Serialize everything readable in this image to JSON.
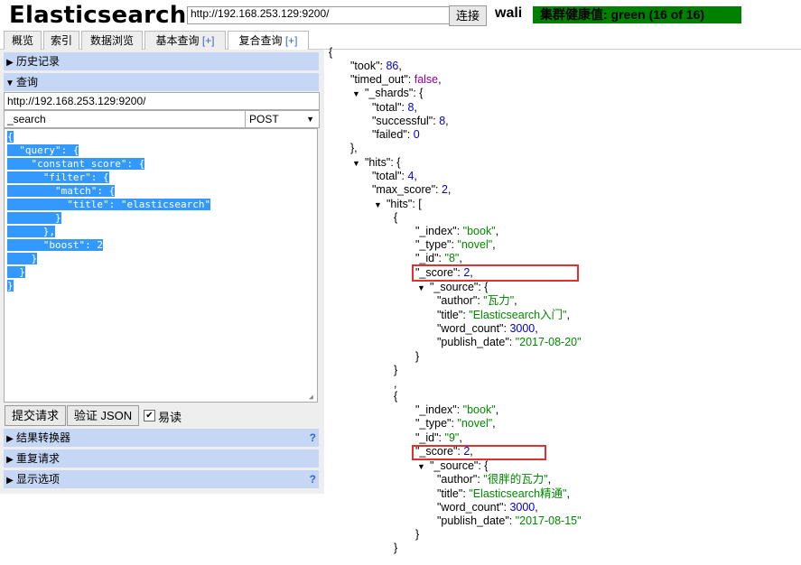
{
  "header": {
    "logo": "Elasticsearch",
    "url": "http://192.168.253.129:9200/",
    "connect_label": "连接",
    "cluster_name": "wali",
    "health": "集群健康值: green (16 of 16)"
  },
  "tabs": [
    {
      "label": "概览",
      "plus": ""
    },
    {
      "label": "索引",
      "plus": ""
    },
    {
      "label": "数据浏览",
      "plus": ""
    },
    {
      "label": "基本查询",
      "plus": "[+]"
    },
    {
      "label": "复合查询",
      "plus": "[+]"
    }
  ],
  "left": {
    "history_label": "历史记录",
    "query_label": "查询",
    "query_url": "http://192.168.253.129:9200/",
    "query_path": "_search",
    "method": "POST",
    "request_body": [
      "{",
      "  \"query\": {",
      "    \"constant_score\": {",
      "      \"filter\": {",
      "        \"match\": {",
      "          \"title\": \"elasticsearch\"",
      "        }",
      "      },",
      "      \"boost\": 2",
      "    }",
      "  }",
      "}"
    ],
    "submit_label": "提交请求",
    "validate_label": "验证 JSON",
    "readonly_label": "易读",
    "transformer_label": "结果转换器",
    "repeat_label": "重复请求",
    "display_label": "显示选项",
    "help_mark": "?"
  },
  "result": {
    "took": "86",
    "timed_out": "false",
    "shards_total": "8",
    "shards_successful": "8",
    "shards_failed": "0",
    "hits_total": "4",
    "max_score": "2",
    "hit1": {
      "index": "\"book\"",
      "type": "\"novel\"",
      "id": "\"8\"",
      "score": "2",
      "author": "\"瓦力\"",
      "title": "\"Elasticsearch入门\"",
      "word_count": "3000",
      "publish_date": "\"2017-08-20\""
    },
    "hit2": {
      "index": "\"book\"",
      "type": "\"novel\"",
      "id": "\"9\"",
      "score": "2",
      "author": "\"很胖的瓦力\"",
      "title": "\"Elasticsearch精通\"",
      "word_count": "3000",
      "publish_date": "\"2017-08-15\""
    }
  },
  "colors": {
    "health_bg": "#008000",
    "section_bg": "#c5d7f5",
    "selection": "#3399ff",
    "highlight_box": "#e03030"
  }
}
